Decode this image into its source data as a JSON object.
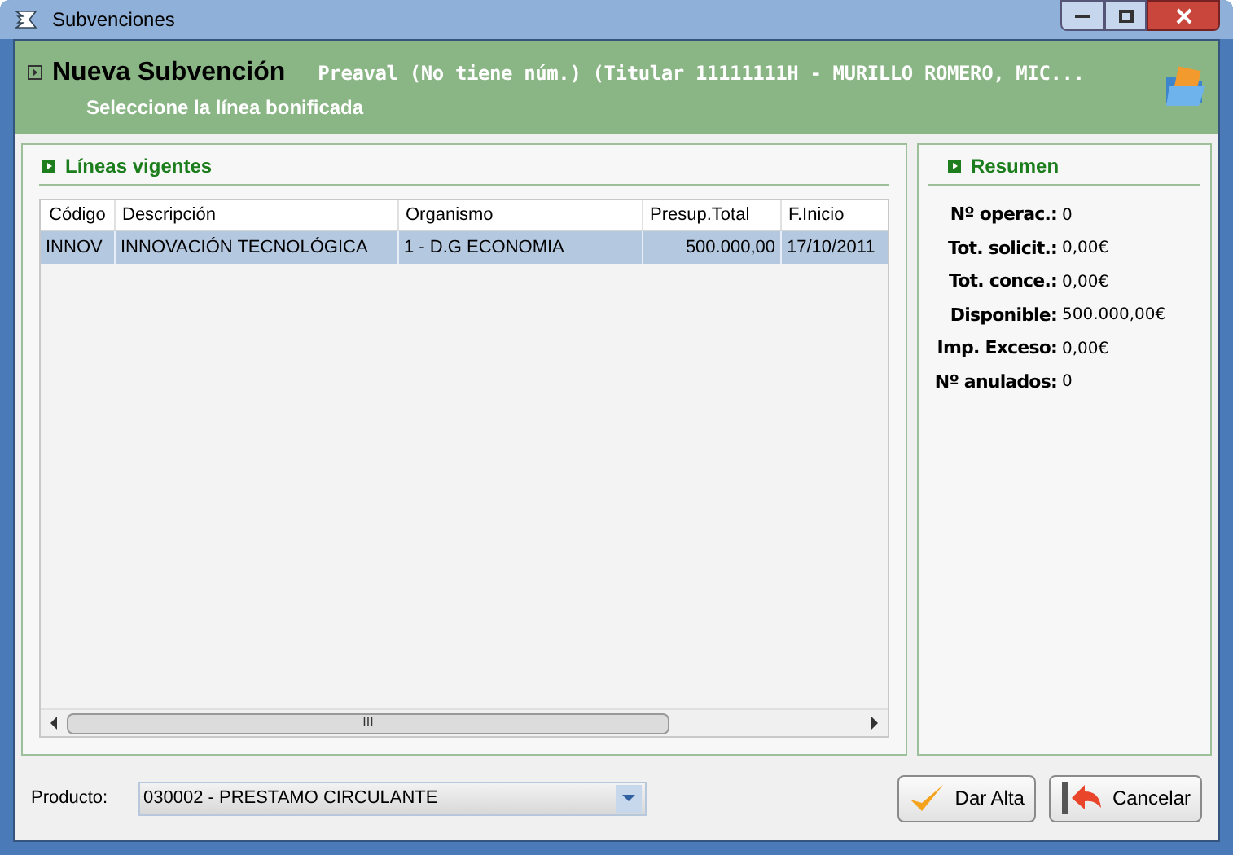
{
  "window": {
    "title": "Subvenciones"
  },
  "header": {
    "title": "Nueva Subvención",
    "subtitle": "Preaval (No tiene núm.) (Titular 11111111H - MURILLO ROMERO, MIC...",
    "instruction": "Seleccione la línea bonificada"
  },
  "lineas": {
    "title": "Líneas vigentes",
    "columns": [
      "Código",
      "Descripción",
      "Organismo",
      "Presup.Total",
      "F.Inicio"
    ],
    "rows": [
      {
        "selected": true,
        "cells": [
          "INNOV",
          "INNOVACIÓN TECNOLÓGICA",
          "1 - D.G ECONOMIA",
          "500.000,00",
          "17/10/2011"
        ]
      }
    ],
    "scroll_thumb": "III"
  },
  "resumen": {
    "title": "Resumen",
    "items": [
      {
        "label": "Nº operac.:",
        "value": "0"
      },
      {
        "label": "Tot. solicit.:",
        "value": "0,00€"
      },
      {
        "label": "Tot. conce.:",
        "value": "0,00€"
      },
      {
        "label": "Disponible:",
        "value": "500.000,00€"
      },
      {
        "label": "Imp. Exceso:",
        "value": "0,00€"
      },
      {
        "label": "Nº anulados:",
        "value": "0"
      }
    ]
  },
  "producto": {
    "label": "Producto:",
    "value": "030002 - PRESTAMO CIRCULANTE"
  },
  "buttons": [
    {
      "kind": "accept",
      "label": "Dar Alta"
    },
    {
      "kind": "cancel",
      "label": "Cancelar"
    }
  ]
}
